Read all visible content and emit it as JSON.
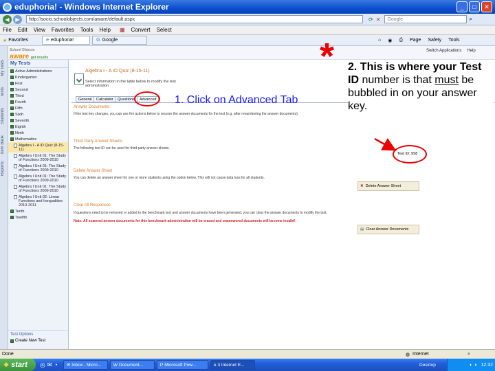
{
  "browser": {
    "title": "eduphoria! - Windows Internet Explorer",
    "url": "http://socio.schoolobjects.com/aware/default.aspx",
    "search_placeholder": "Google",
    "menu": [
      "File",
      "Edit",
      "View",
      "Favorites",
      "Tools",
      "Help"
    ],
    "toolbar_convert": "Convert",
    "toolbar_select": "Select",
    "favorites": "Favorites",
    "tabs": [
      "eduphoria!",
      "Google"
    ],
    "right_tools": [
      "Page",
      "Safety",
      "Tools"
    ],
    "status": "Done",
    "zone": "Internet"
  },
  "app": {
    "logo_top": "School Objects",
    "logo_main": "aware",
    "logo_sub": "get results",
    "switch_apps": "Switch Applications",
    "help": "Help",
    "sidebar_vertical_tabs": [
      "My Tests",
      "Tests",
      "Students",
      "Item Bank",
      "Reports"
    ]
  },
  "tree": {
    "header": "My Tests",
    "items": [
      {
        "label": "Active Administrations",
        "kind": "folder"
      },
      {
        "label": "Kindergarten",
        "kind": "folder"
      },
      {
        "label": "First",
        "kind": "folder"
      },
      {
        "label": "Second",
        "kind": "folder"
      },
      {
        "label": "Third",
        "kind": "folder"
      },
      {
        "label": "Fourth",
        "kind": "folder"
      },
      {
        "label": "Fifth",
        "kind": "folder"
      },
      {
        "label": "Sixth",
        "kind": "folder"
      },
      {
        "label": "Seventh",
        "kind": "folder"
      },
      {
        "label": "Eighth",
        "kind": "folder"
      },
      {
        "label": "Ninth",
        "kind": "folder"
      },
      {
        "label": "Mathematics",
        "kind": "folder"
      },
      {
        "label": "Algebra I - A ID Quiz (8-15-11)",
        "kind": "doc",
        "selected": true
      },
      {
        "label": "Algebra I Unit 01: The Study of Functions 2009-2010",
        "kind": "doc"
      },
      {
        "label": "Algebra I Unit 01: The Study of Functions 2009-2010",
        "kind": "doc"
      },
      {
        "label": "Algebra I Unit 01: The Study of Functions 2009-2010",
        "kind": "doc"
      },
      {
        "label": "Algebra I Unit 01: The Study of Functions 2009-2010",
        "kind": "doc"
      },
      {
        "label": "Algebra I Unit 02: Linear Functions and Inequalities 2010-2011",
        "kind": "doc"
      },
      {
        "label": "Tenth",
        "kind": "folder"
      },
      {
        "label": "Twelfth",
        "kind": "folder"
      }
    ],
    "test_options": "Test Options",
    "create_new_test": "Create New Test"
  },
  "main": {
    "test_title": "Algebra I - A ID Quiz (8-15-11)",
    "subtitle": "Select information in the table below to modify the test administration",
    "tabs": [
      "General",
      "Calculator",
      "Questions",
      "Advanced"
    ],
    "section1_title": "Answer Documents",
    "section1_text": "If the test key changes, you can use the actions below to rescore the answer documents for the test (e.g. after renumbering the answer documents).",
    "section2_title": "Third Party Answer Sheets",
    "section2_text": "The following test ID can be used for third party answer sheets.",
    "test_id_label": "Test ID: 958",
    "section3_title": "Delete Answer Sheet",
    "section3_text": "You can delete an answer sheet for one or more students using the option below. This will not cause data loss for all students.",
    "delete_button": "Delete Answer Sheet",
    "section4_title": "Clear All Responses",
    "section4_text": "If questions need to be removed or added to the benchmark test and answer documents have been generated, you can clear the answer documents to modify the test.",
    "warning": "Note: All scanned answer documents for this benchmark administration will be erased and unanswered documents will become invalid!",
    "clear_button": "Clear Answer Documents"
  },
  "annotations": {
    "step1": "1. Click on Advanced Tab",
    "star": "*",
    "step2_prefix": "2. This is where your ",
    "step2_bold": "Test ID",
    "step2_mid": " number is that ",
    "step2_underline": "must",
    "step2_suffix": " be bubbled in on your answer key."
  },
  "taskbar": {
    "start": "start",
    "tasks": [
      "Inbox - Micro...",
      "Document...",
      "Microsoft Pow...",
      "3 Internet E..."
    ],
    "lang": "Desktop",
    "time": "12:32"
  }
}
